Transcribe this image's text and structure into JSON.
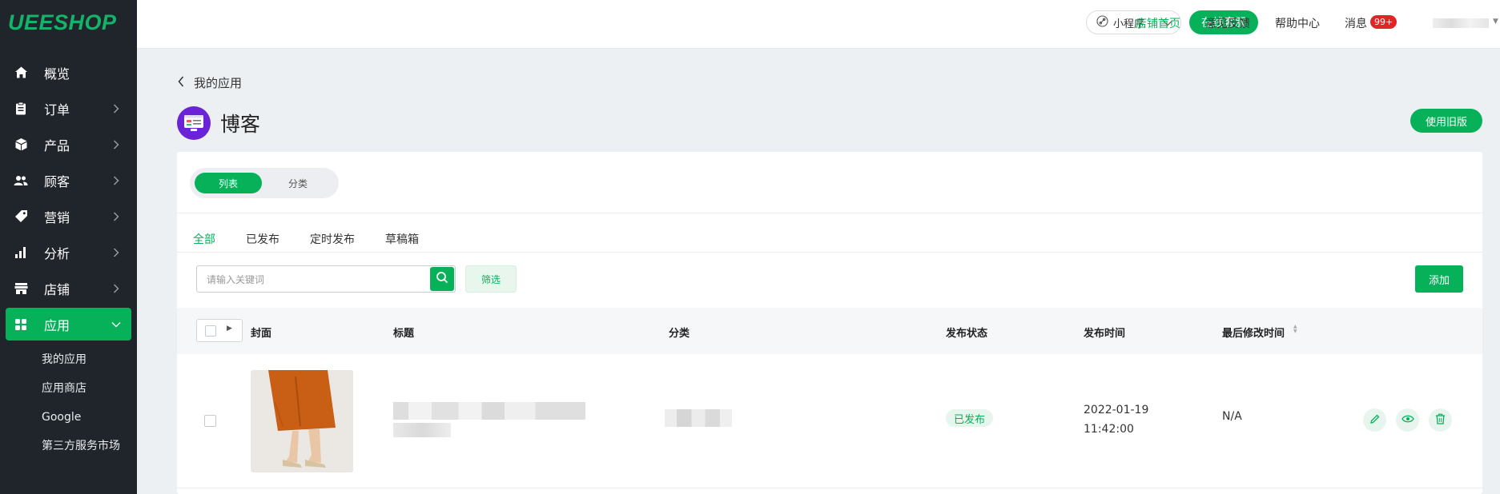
{
  "logo": "UEESHOP",
  "sidebar": {
    "items": [
      {
        "label": "概览"
      },
      {
        "label": "订单"
      },
      {
        "label": "产品"
      },
      {
        "label": "顾客"
      },
      {
        "label": "营销"
      },
      {
        "label": "分析"
      },
      {
        "label": "店铺"
      },
      {
        "label": "应用"
      }
    ],
    "sub_items": [
      {
        "label": "我的应用"
      },
      {
        "label": "应用商店"
      },
      {
        "label": "Google"
      },
      {
        "label": "第三方服务市场"
      }
    ]
  },
  "topbar": {
    "mini_program": "小程序",
    "online_service": "在线客服",
    "store_home": "店铺首页",
    "feedback": "意见反馈",
    "help_center": "帮助中心",
    "messages": "消息",
    "messages_badge": "99+"
  },
  "page": {
    "back_label": "我的应用",
    "app_title": "博客",
    "use_old_version": "使用旧版"
  },
  "segment": {
    "list": "列表",
    "category": "分类"
  },
  "tabs": [
    {
      "label": "全部"
    },
    {
      "label": "已发布"
    },
    {
      "label": "定时发布"
    },
    {
      "label": "草稿箱"
    }
  ],
  "search": {
    "placeholder": "请输入关键词"
  },
  "filter_label": "筛选",
  "add_label": "添加",
  "table": {
    "headers": {
      "cover": "封面",
      "title": "标题",
      "category": "分类",
      "status": "发布状态",
      "publish_time": "发布时间",
      "modified_time": "最后修改时间"
    },
    "rows": [
      {
        "status": "已发布",
        "publish_date": "2022-01-19",
        "publish_clock": "11:42:00",
        "modified": "N/A"
      }
    ]
  },
  "colors": {
    "accent": "#07b15a",
    "sidebar_bg": "#20252b",
    "badge": "#e02525"
  }
}
